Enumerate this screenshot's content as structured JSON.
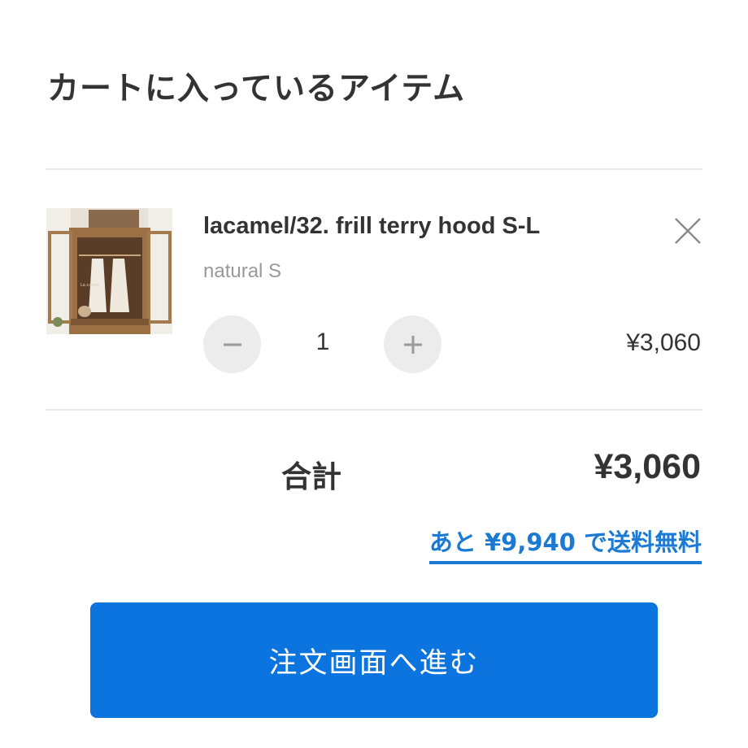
{
  "cart": {
    "title": "カートに入っているアイテム"
  },
  "item": {
    "name": "lacamel/32. frill terry hood S-L",
    "variant": "natural S",
    "quantity": "1",
    "price": "¥3,060",
    "image_icon": "clothes-cabinet-photo",
    "image_watermark": "La.camel",
    "remove_icon": "close-icon",
    "minus_icon": "minus-icon",
    "plus_icon": "plus-icon"
  },
  "summary": {
    "total_label": "合計",
    "total_value": "¥3,060",
    "free_shipping_text": "あと ¥9,940 で送料無料"
  },
  "checkout": {
    "label": "注文画面へ進む"
  },
  "colors": {
    "accent": "#0b74de",
    "link": "#1a7ad4",
    "text": "#333333",
    "muted": "#999999",
    "qty_button_bg": "#ececec"
  }
}
